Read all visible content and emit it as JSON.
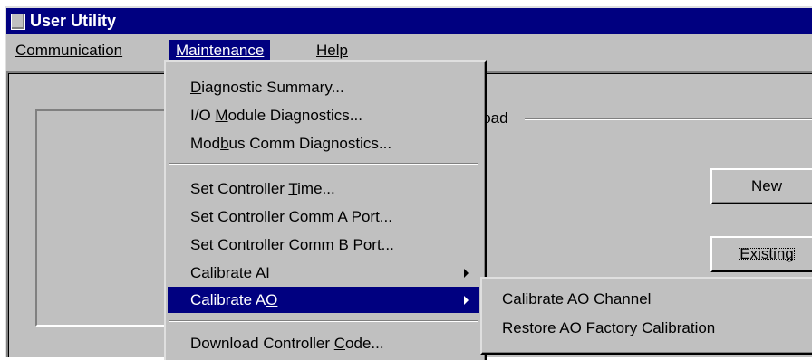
{
  "window": {
    "title": "User Utility"
  },
  "menubar": {
    "communication": "Communication",
    "maintenance": "Maintenance",
    "help": "Help"
  },
  "main": {
    "group_label": "nload",
    "new_button": "New",
    "existing_button": "Existing"
  },
  "maintenance_menu": [
    {
      "pre": "",
      "key": "D",
      "post": "iagnostic Summary..."
    },
    {
      "pre": "I/O ",
      "key": "M",
      "post": "odule Diagnostics..."
    },
    {
      "pre": "Mod",
      "key": "b",
      "post": "us Comm Diagnostics..."
    },
    {
      "pre": "Set Controller ",
      "key": "T",
      "post": "ime..."
    },
    {
      "pre": "Set Controller Comm ",
      "key": "A",
      "post": " Port..."
    },
    {
      "pre": "Set Controller Comm ",
      "key": "B",
      "post": " Port..."
    },
    {
      "pre": "Calibrate A",
      "key": "I",
      "post": ""
    },
    {
      "pre": "Calibrate A",
      "key": "O",
      "post": ""
    },
    {
      "pre": "Download Controller ",
      "key": "C",
      "post": "ode..."
    }
  ],
  "calibrate_ao_submenu": [
    "Calibrate AO Channel",
    "Restore AO Factory Calibration"
  ]
}
